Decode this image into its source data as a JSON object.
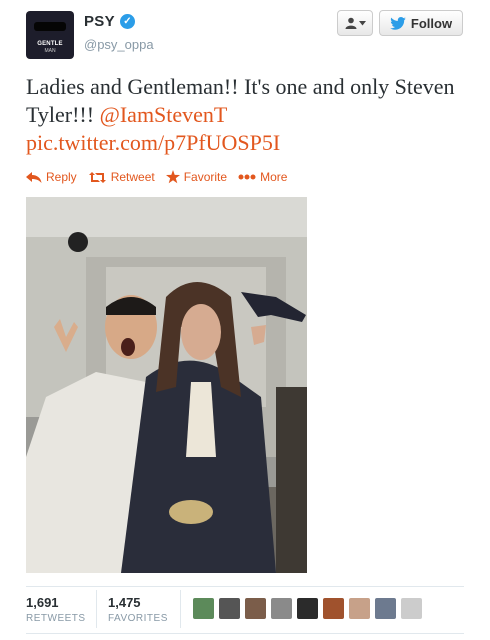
{
  "profile": {
    "name": "PSY",
    "handle": "@psy_oppa",
    "verified": true,
    "avatar_text_1": "GENTLE",
    "avatar_text_2": "MAN"
  },
  "buttons": {
    "follow_label": "Follow"
  },
  "tweet": {
    "text_part1": "Ladies and Gentleman!! It's one and only Steven Tyler!!! ",
    "mention": "@IamStevenT",
    "pic_link": "pic.twitter.com/p7PfUOSP5I"
  },
  "actions": {
    "reply": "Reply",
    "retweet": "Retweet",
    "favorite": "Favorite",
    "more": "More"
  },
  "stats": {
    "retweets_count": "1,691",
    "retweets_label": "RETWEETS",
    "favorites_count": "1,475",
    "favorites_label": "FAVORITES"
  },
  "colors": {
    "link": "#e2571e",
    "verified": "#2b9de8",
    "twitter_bird": "#2b9de8"
  },
  "icons": {
    "verified": "verified-badge-icon",
    "user": "user-icon",
    "bird": "twitter-bird-icon",
    "reply": "reply-arrow-icon",
    "retweet": "retweet-icon",
    "favorite": "star-icon",
    "more": "more-dots-icon"
  }
}
